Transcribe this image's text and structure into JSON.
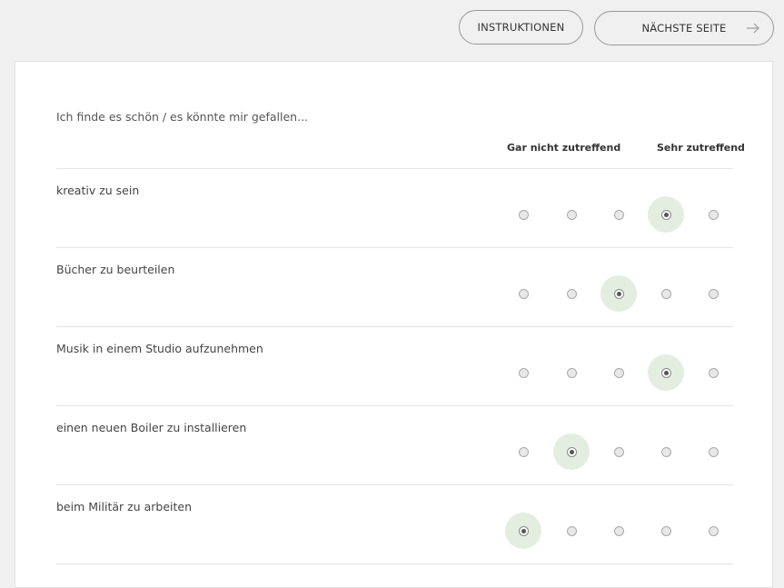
{
  "toolbar": {
    "instructions_label": "INSTRUKTIONEN",
    "next_label": "NÄCHSTE SEITE"
  },
  "survey": {
    "intro": "Ich finde es schön / es könnte mir gefallen...",
    "scale_min_label": "Gar nicht zutreffend",
    "scale_max_label": "Sehr zutreffend",
    "scale_points": 5,
    "items": [
      {
        "label": "kreativ zu sein",
        "selected": 4
      },
      {
        "label": "Bücher zu beurteilen",
        "selected": 3
      },
      {
        "label": "Musik in einem Studio aufzunehmen",
        "selected": 4
      },
      {
        "label": "einen neuen Boiler zu installieren",
        "selected": 2
      },
      {
        "label": "beim Militär zu arbeiten",
        "selected": 1
      }
    ]
  },
  "colors": {
    "page_background": "#f0f0f0",
    "card_background": "#ffffff",
    "selected_highlight": "#e3eee0"
  },
  "icons": {
    "next_arrow": "arrow-right-icon"
  }
}
